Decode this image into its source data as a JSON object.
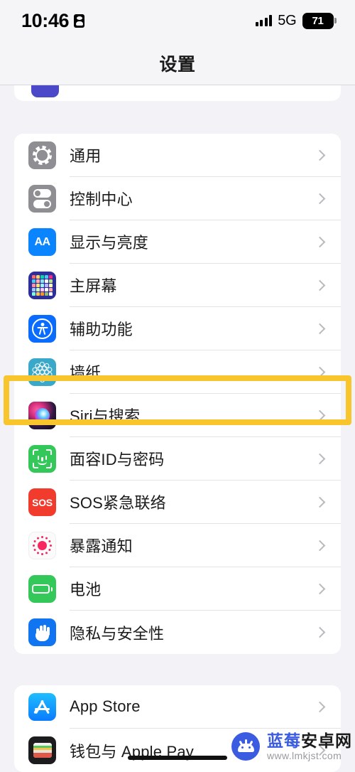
{
  "status_bar": {
    "time": "10:46",
    "recording_icon": "id-card-icon",
    "signal_icon": "cellular-signal-icon",
    "network": "5G",
    "battery_level": "71"
  },
  "nav": {
    "title": "设置"
  },
  "highlight": {
    "target": "辅助功能",
    "color": "#F8C52C"
  },
  "groups": [
    {
      "id": "main-group",
      "items": [
        {
          "label": "通用",
          "icon": "gear-icon",
          "color": "#8E8E93"
        },
        {
          "label": "控制中心",
          "icon": "toggles-icon",
          "color": "#8E8E93"
        },
        {
          "label": "显示与亮度",
          "icon": "text-size-aa-icon",
          "color": "#0A84FF"
        },
        {
          "label": "主屏幕",
          "icon": "app-grid-icon",
          "color": "#2C2F9B"
        },
        {
          "label": "辅助功能",
          "icon": "accessibility-icon",
          "color": "#0A6CFF"
        },
        {
          "label": "墙纸",
          "icon": "wallpaper-flower-icon",
          "color": "#3AA8C9"
        },
        {
          "label": "Siri与搜索",
          "icon": "siri-orb-icon",
          "color": "#D62E7E"
        },
        {
          "label": "面容ID与密码",
          "icon": "face-id-icon",
          "color": "#34C759"
        },
        {
          "label": "SOS紧急联络",
          "icon": "sos-icon",
          "color": "#F03B2D"
        },
        {
          "label": "暴露通知",
          "icon": "exposure-notification-icon",
          "color": "#F8275F"
        },
        {
          "label": "电池",
          "icon": "battery-icon",
          "color": "#34C759"
        },
        {
          "label": "隐私与安全性",
          "icon": "hand-privacy-icon",
          "color": "#1175F2"
        }
      ]
    },
    {
      "id": "store-group",
      "items": [
        {
          "label": "App Store",
          "icon": "app-store-icon",
          "color": "#0A7BFF"
        },
        {
          "label": "钱包与 Apple Pay",
          "icon": "wallet-icon",
          "color": "#1C1C1E"
        }
      ]
    }
  ],
  "watermark": {
    "site_name": "蓝莓安卓网",
    "url": "www.lmkjst.com",
    "logo": "android-mascot-icon"
  },
  "home_indicator": "home-indicator"
}
